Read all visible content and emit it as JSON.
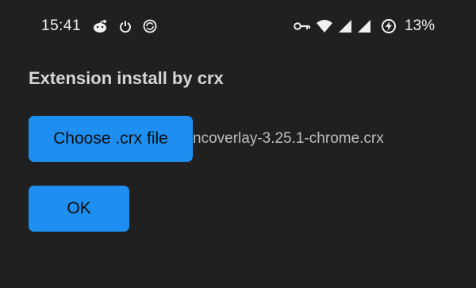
{
  "status_bar": {
    "time": "15:41",
    "left_icons": [
      "reddit-alien-icon",
      "power-icon",
      "sync-icon"
    ],
    "right_icons": [
      "vpn-key-icon",
      "wifi-icon",
      "cell-signal-icon",
      "cell-signal-icon",
      "battery-charging-icon"
    ],
    "battery_percent": "13%"
  },
  "main": {
    "title": "Extension install by crx",
    "choose_button_label": "Choose .crx file",
    "selected_file": "ncoverlay-3.25.1-chrome.crx",
    "ok_button_label": "OK"
  },
  "colors": {
    "background": "#202020",
    "button": "#1e8ff0",
    "button_text": "#0c0c0c",
    "title_text": "#d6d6d6",
    "file_text": "#bdbdbd"
  }
}
